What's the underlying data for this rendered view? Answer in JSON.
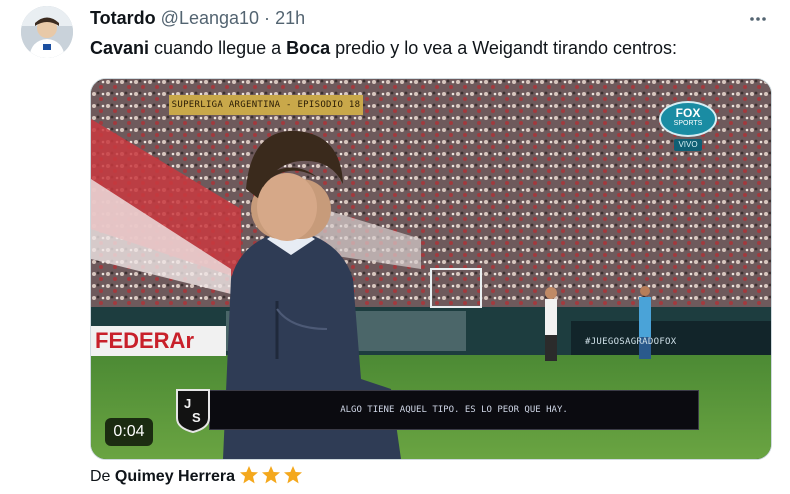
{
  "tweet": {
    "author_name": "Totardo",
    "handle": "@Leanga10",
    "separator": "·",
    "time": "21h",
    "text_parts": [
      {
        "text": "Cavani",
        "bold": true
      },
      {
        "text": " cuando llegue a ",
        "bold": false
      },
      {
        "text": "Boca",
        "bold": true
      },
      {
        "text": " predio y lo vea a Weigandt tirando centros:",
        "bold": false
      }
    ]
  },
  "video": {
    "episode_label": "SUPERLIGA ARGENTINA - EPISODIO 18",
    "channel_logo_text": "FOX",
    "channel_logo_subtext": "SPORTS",
    "channel_live_label": "VIVO",
    "ad_board_text": "FEDERAr",
    "hashtag": "#JUEGOSAGRADOFOX",
    "subtitle": "ALGO TIENE AQUEL TIPO. ES LO PEOR QUE HAY.",
    "watermark_logo": "JS",
    "elapsed": "0:04"
  },
  "source": {
    "prefix": "De",
    "name": "Quimey Herrera",
    "star_icons": [
      "star-icon",
      "star-icon",
      "star-icon"
    ]
  },
  "colors": {
    "star": "#f4a81d",
    "secondary_text": "#536471",
    "pitch": "#3e7a2a"
  }
}
